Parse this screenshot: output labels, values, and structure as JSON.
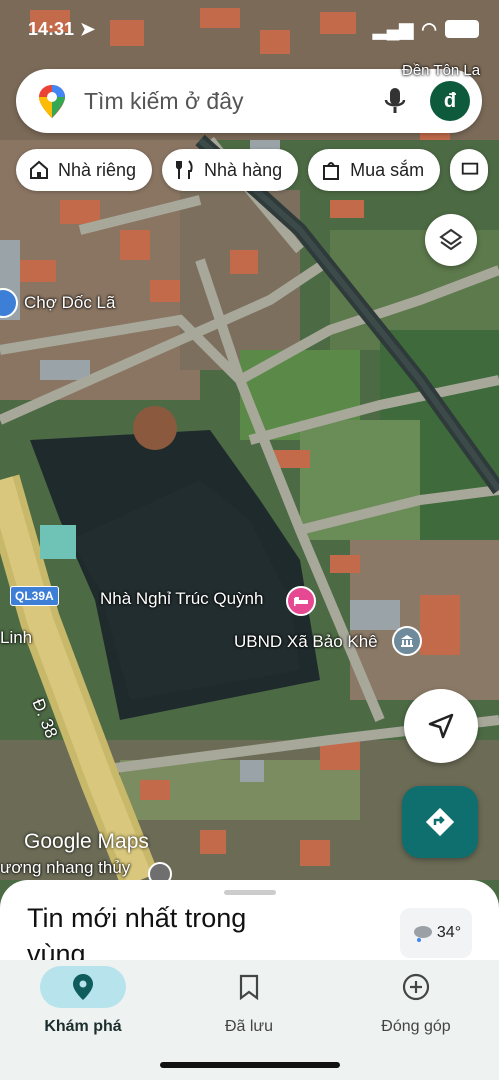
{
  "status_bar": {
    "time": "14:31"
  },
  "search": {
    "placeholder": "Tìm kiếm ở đây",
    "avatar_letter": "đ"
  },
  "chips": [
    {
      "label": "Nhà riêng",
      "icon": "home-icon"
    },
    {
      "label": "Nhà hàng",
      "icon": "restaurant-icon"
    },
    {
      "label": "Mua sắm",
      "icon": "shopping-icon"
    }
  ],
  "map": {
    "labels": {
      "market": "Chợ Dốc Lã",
      "guesthouse": "Nhà Nghỉ Trúc Quỳnh",
      "ubnd": "UBND Xã Bảo Khê",
      "road_ql": "QL39A",
      "road_d38": "Đ. 38",
      "edge_left": "Linh",
      "top_right": "Đền Tôn La",
      "bottom_left": "ương nhang thủy"
    },
    "brand": "Google Maps"
  },
  "sheet": {
    "title": "Tin mới nhất trong vùng",
    "temperature": "34°"
  },
  "nav": [
    {
      "label": "Khám phá",
      "icon": "explore-pin-icon",
      "active": true
    },
    {
      "label": "Đã lưu",
      "icon": "bookmark-icon",
      "active": false
    },
    {
      "label": "Đóng góp",
      "icon": "add-circle-icon",
      "active": false
    }
  ],
  "colors": {
    "accent": "#0f6e6e",
    "active_pill": "#b7e3ed",
    "poi_pink": "#e64992"
  }
}
